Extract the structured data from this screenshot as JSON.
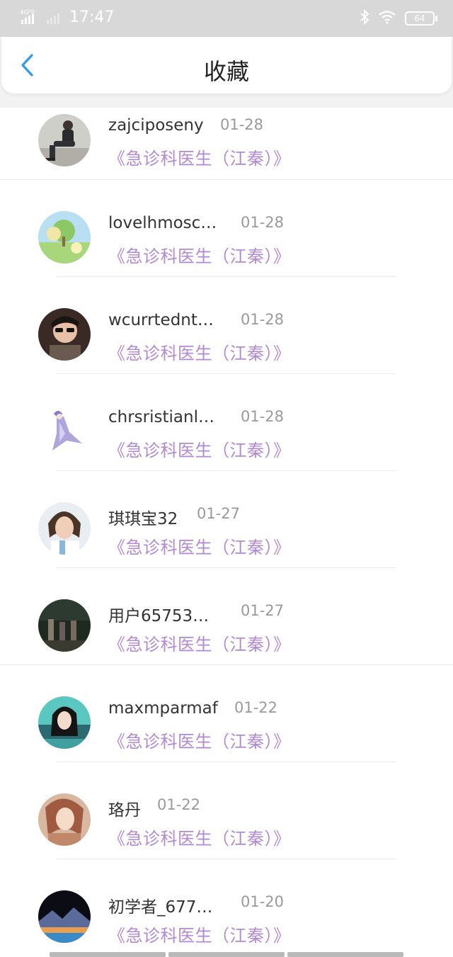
{
  "status_bar": {
    "network": "4G HD",
    "time": "17:47",
    "battery": "64"
  },
  "header": {
    "title": "收藏"
  },
  "items": [
    {
      "name": "zajciposeny",
      "date": "01-28",
      "book": "《急诊科医生（江秦）》",
      "avatar": "man-in-suit"
    },
    {
      "name": "lovelhmosc…",
      "date": "01-28",
      "book": "《急诊科医生（江秦）》",
      "avatar": "landscape-tree"
    },
    {
      "name": "wcurrtednt…",
      "date": "01-28",
      "book": "《急诊科医生（江秦）》",
      "avatar": "man-sunglasses"
    },
    {
      "name": "chrsristianl…",
      "date": "01-28",
      "book": "《急诊科医生（江秦）》",
      "avatar": "anime-figure"
    },
    {
      "name": "琪琪宝32",
      "date": "01-27",
      "book": "《急诊科医生（江秦）》",
      "avatar": "woman-portrait"
    },
    {
      "name": "用户65753…",
      "date": "01-27",
      "book": "《急诊科医生（江秦）》",
      "avatar": "dark-scene"
    },
    {
      "name": "maxmparmaf",
      "date": "01-22",
      "book": "《急诊科医生（江秦）》",
      "avatar": "girl-teal"
    },
    {
      "name": "珞丹",
      "date": "01-22",
      "book": "《急诊科医生（江秦）》",
      "avatar": "woman-warm"
    },
    {
      "name": "初学者_677…",
      "date": "01-20",
      "book": "《急诊科医生（江秦）》",
      "avatar": "mountain-lake"
    }
  ]
}
